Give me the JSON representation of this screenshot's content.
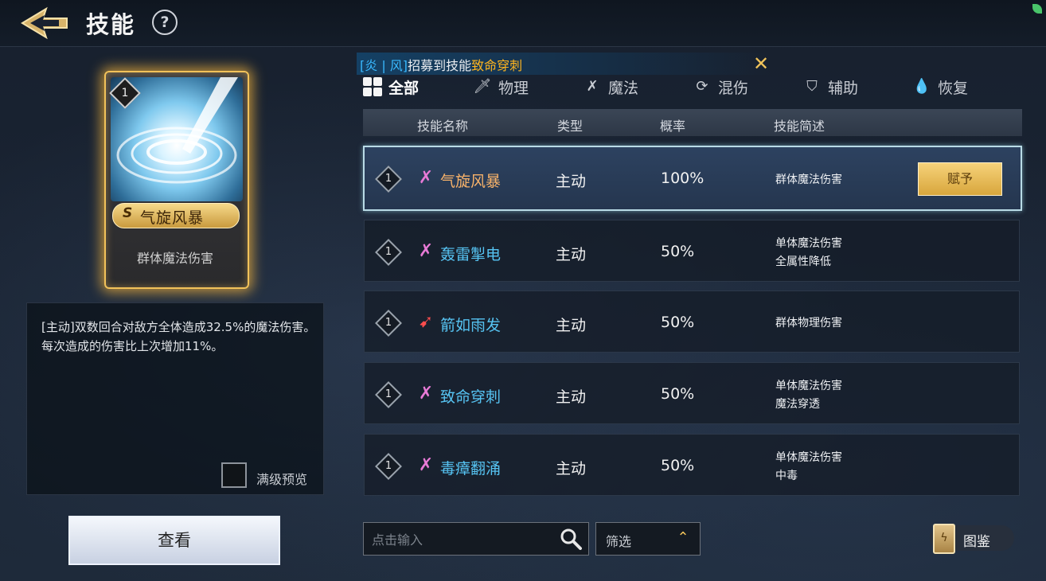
{
  "header": {
    "title": "技能",
    "help": "?"
  },
  "card": {
    "level": "1",
    "grade": "S",
    "name": "气旋风暴",
    "desc": "群体魔法伤害"
  },
  "detail": {
    "text": "[主动]双数回合对敌方全体造成32.5%的魔法伤害。每次造成的伤害比上次增加11%。",
    "max_preview_label": "满级预览"
  },
  "view_button": "查看",
  "notice": {
    "tag": "[炎 | 风]",
    "text": "招募到技能",
    "skill": "致命穿刺",
    "close": "✕"
  },
  "tabs": [
    {
      "label": "全部",
      "icon": "grid-icon",
      "active": true
    },
    {
      "label": "物理",
      "icon": "sword-icon"
    },
    {
      "label": "魔法",
      "icon": "magic-icon"
    },
    {
      "label": "混伤",
      "icon": "mixed-icon"
    },
    {
      "label": "辅助",
      "icon": "shield-icon"
    },
    {
      "label": "恢复",
      "icon": "drop-icon"
    }
  ],
  "table": {
    "headers": {
      "name": "技能名称",
      "type": "类型",
      "rate": "概率",
      "brief": "技能简述"
    },
    "rows": [
      {
        "level": "1",
        "icon": "magic-icon",
        "name": "气旋风暴",
        "type": "主动",
        "rate": "100%",
        "brief1": "群体魔法伤害",
        "brief2": "",
        "selected": true,
        "action": "赋予"
      },
      {
        "level": "1",
        "icon": "magic-icon",
        "name": "轰雷掣电",
        "type": "主动",
        "rate": "50%",
        "brief1": "单体魔法伤害",
        "brief2": "全属性降低"
      },
      {
        "level": "1",
        "icon": "physical-icon",
        "name": "箭如雨发",
        "type": "主动",
        "rate": "50%",
        "brief1": "群体物理伤害",
        "brief2": ""
      },
      {
        "level": "1",
        "icon": "magic-icon",
        "name": "致命穿刺",
        "type": "主动",
        "rate": "50%",
        "brief1": "单体魔法伤害",
        "brief2": "魔法穿透"
      },
      {
        "level": "1",
        "icon": "magic-icon",
        "name": "毒瘴翻涌",
        "type": "主动",
        "rate": "50%",
        "brief1": "单体魔法伤害",
        "brief2": "中毒"
      }
    ]
  },
  "search": {
    "placeholder": "点击输入",
    "value": ""
  },
  "filter": {
    "label": "筛选"
  },
  "codex": {
    "label": "图鉴",
    "icon": "ϟ"
  },
  "colors": {
    "accent_gold": "#f2c25a",
    "skill_blue": "#56c3f2",
    "skill_selected": "#f7b26a",
    "notice_tag": "#39b9ff",
    "notice_skill": "#ffb51f"
  }
}
